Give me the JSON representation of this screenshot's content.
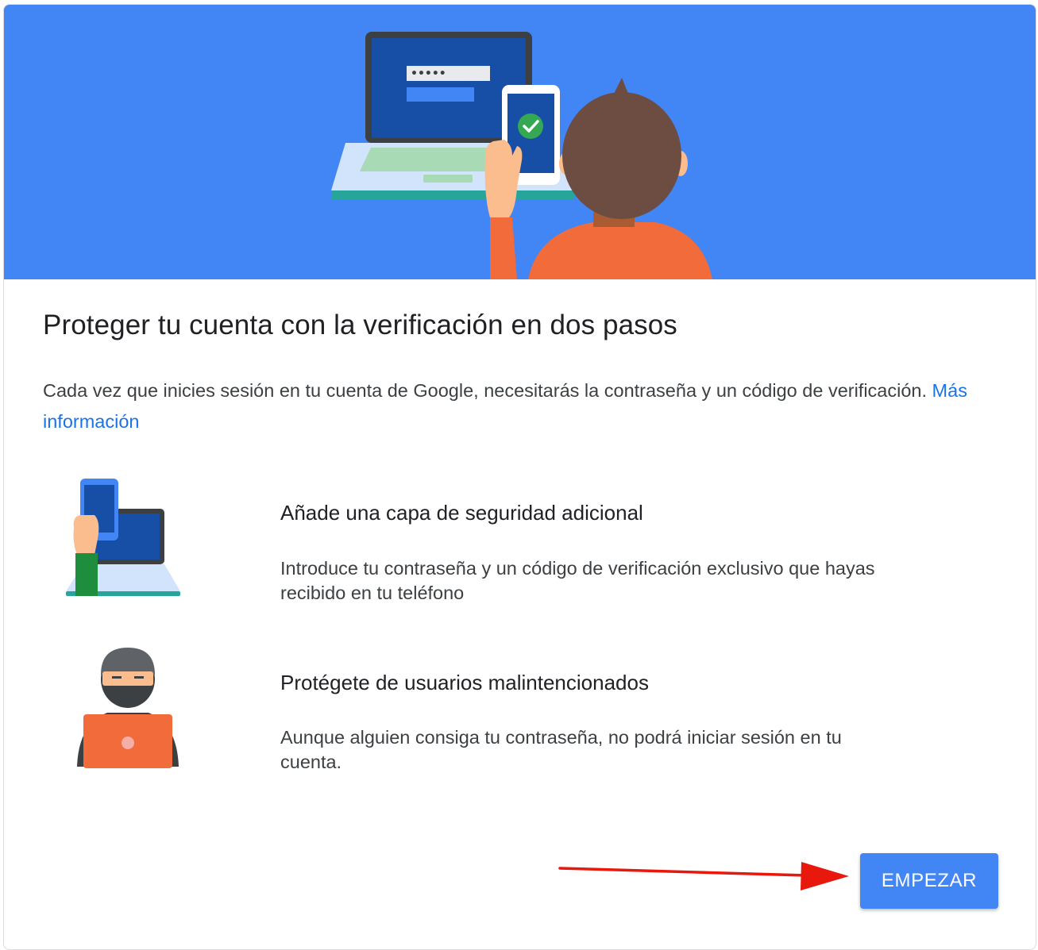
{
  "hero": {
    "illustration": "person-with-laptop-and-phone-illustration",
    "password_mask": "•••••",
    "check_icon": "check-circle-icon"
  },
  "main": {
    "title": "Proteger tu cuenta con la verificación en dos pasos",
    "description": "Cada vez que inicies sesión en tu cuenta de Google, necesitarás la contraseña y un código de verificación.",
    "learn_more_link": "Más información"
  },
  "features": [
    {
      "illustration": "phone-and-laptop-illustration",
      "title": "Añade una capa de seguridad adicional",
      "text": "Introduce tu contraseña y un código de verificación exclusivo que hayas recibido en tu teléfono"
    },
    {
      "illustration": "hacker-illustration",
      "title": "Protégete de usuarios malintencionados",
      "text": "Aunque alguien consiga tu contraseña, no podrá iniciar sesión en tu cuenta."
    }
  ],
  "footer": {
    "start_button": "EMPEZAR",
    "arrow_icon": "red-arrow-icon"
  },
  "colors": {
    "hero_background": "#4285f4",
    "primary_button": "#4285f4",
    "link": "#1a73e8",
    "arrow": "#e8180c"
  }
}
